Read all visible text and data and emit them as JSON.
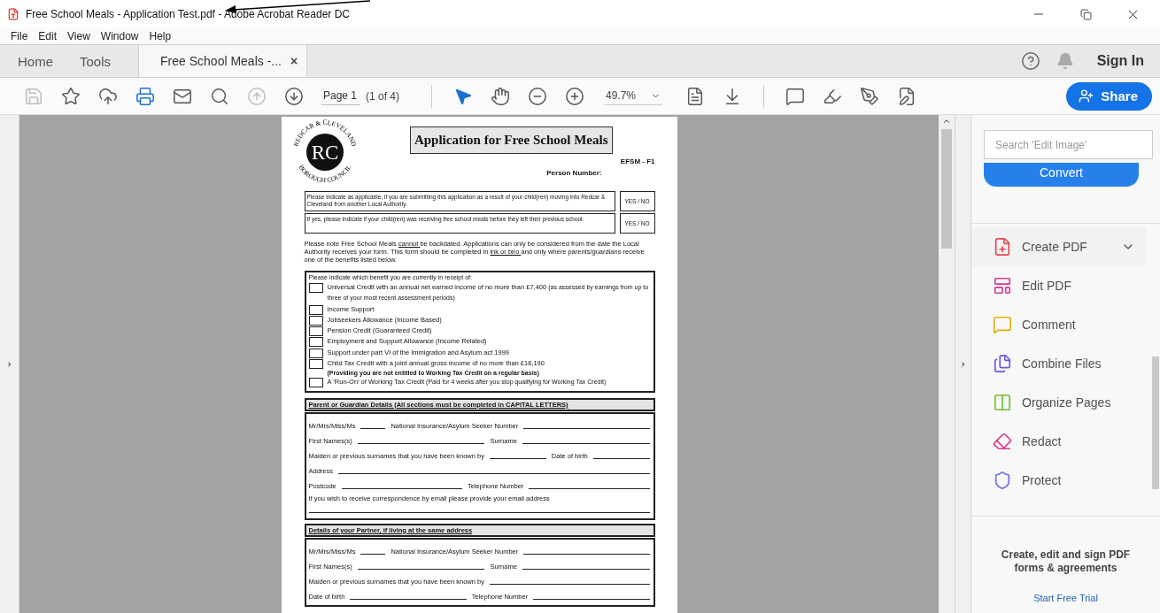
{
  "window": {
    "title": "Free School Meals - Application Test.pdf - Adobe Acrobat Reader DC"
  },
  "menu": [
    "File",
    "Edit",
    "View",
    "Window",
    "Help"
  ],
  "tabs": [
    {
      "label": "Home",
      "selected": false
    },
    {
      "label": "Tools",
      "selected": false
    },
    {
      "label": "Free School Meals -...",
      "selected": true,
      "close": "×"
    }
  ],
  "account": {
    "sign_in": "Sign In"
  },
  "toolbar": {
    "buttons": [
      {
        "kind": "save",
        "disabled": true
      },
      {
        "kind": "bookmark",
        "disabled": false
      },
      {
        "kind": "upload",
        "disabled": false
      },
      {
        "kind": "print",
        "disabled": false
      },
      {
        "kind": "email",
        "disabled": false
      },
      {
        "kind": "find",
        "disabled": false
      },
      {
        "kind": "previous",
        "disabled": true
      },
      {
        "kind": "next",
        "disabled": false
      }
    ],
    "page_field": "Page 1",
    "page_count": "(1 of 4)",
    "view_tools": [
      {
        "kind": "select",
        "selected": true
      },
      {
        "kind": "hand",
        "selected": false
      },
      {
        "kind": "zoom_out",
        "selected": false
      },
      {
        "kind": "zoom_in",
        "selected": false
      }
    ],
    "zoom": "49.7%",
    "edit_tools": [
      {
        "kind": "fit_page"
      },
      {
        "kind": "scroll_mode"
      },
      {
        "kind": "comment"
      },
      {
        "kind": "highlight"
      },
      {
        "kind": "sign"
      },
      {
        "kind": "fill"
      }
    ],
    "share": "Share"
  },
  "document": {
    "logo": {
      "top_text": "REDCAR & CLEVELAND",
      "bottom_text": "BOROUGH COUNCIL",
      "monogram": "RC"
    },
    "title": "Application for Free School Meals",
    "form_code": "EFSM - F1",
    "person_number": "Person Number:",
    "questions": [
      {
        "text": "Please indicate as applicable, if you are submitting this application as a result of your child(ren) moving into Redcar & Cleveland from another Local Authority.",
        "answer": "YES / NO"
      },
      {
        "text": "If yes, please indicate if your child(ren) was receiving free school meals before they left their previous school.",
        "answer": "YES / NO"
      }
    ],
    "notice": [
      {
        "text": "Please note Free School Meals ",
        "underline": false
      },
      {
        "text": "cannot ",
        "underline": true
      },
      {
        "text": "be backdated.  Applications can only be considered from the date the Local Authority receives your form.  This form should be completed in ",
        "underline": false
      },
      {
        "text": "ink or biro ",
        "underline": true
      },
      {
        "text": "and only where parents/guardians receive one of the benefits listed below.",
        "underline": false
      }
    ],
    "benefits": {
      "heading": "Please indicate which benefit you are currently in receipt of:",
      "items": [
        {
          "text": "Universal Credit with an annual net earned income of no more than £7,400",
          "note": {
            "text": "(as assessed by earnings from up to three of your most recent assessment periods)",
            "bold": false
          },
          "checked": false
        },
        {
          "text": "Income Support",
          "checked": false
        },
        {
          "text": "Jobseekers Allowance (Income Based)",
          "checked": false
        },
        {
          "text": "Pension Credit (Guaranteed Credit)",
          "checked": false
        },
        {
          "text": "Employment and Support Allowance (Income Related)",
          "checked": false
        },
        {
          "text": "Support under part VI of the Immigration and Asylum act 1999",
          "checked": false
        },
        {
          "text": "Child Tax Credit with a joint annual gross income of no more than £16,190",
          "note": {
            "text": "(Providing you are not entitled to Working Tax Credit on a regular basis)",
            "bold": true
          },
          "checked": false
        },
        {
          "text": "A ‘Run-On’ of Working Tax Credit",
          "note": {
            "text": "(Paid for 4 weeks after you stop qualifying for Working Tax Credit)",
            "bold": false
          },
          "checked": false
        }
      ]
    },
    "sections": [
      {
        "heading": "Parent or Guardian Details (All sections must be completed in CAPITAL LETTERS)",
        "rows": [
          {
            "fields": [
              {
                "label": "Mr/Mrs/Miss/Ms",
                "kind": "short"
              },
              {
                "label": "National Insurance/Asylum Seeker Number",
                "kind": "inline"
              }
            ]
          },
          {
            "fields": [
              {
                "label": "First Names(s)",
                "kind": "inline"
              },
              {
                "label": "Surname",
                "kind": "inline"
              }
            ]
          },
          {
            "fields": [
              {
                "label": "Maiden or previous surnames that you have been known by",
                "kind": "inline"
              },
              {
                "label": "Date of birth",
                "kind": "inline"
              }
            ]
          },
          {
            "fields": [
              {
                "label": "Address",
                "kind": "inline"
              }
            ]
          },
          {
            "fields": [
              {
                "label": "Postcode",
                "kind": "inline"
              },
              {
                "label": "Telephone Number",
                "kind": "inline"
              }
            ]
          },
          {
            "fields": [
              {
                "label": "If you wish to receive correspondence by email please provide your email address",
                "kind": "below"
              }
            ]
          }
        ]
      },
      {
        "heading": "Details of your Partner, if living at the same address",
        "rows": [
          {
            "fields": [
              {
                "label": "Mr/Mrs/Miss/Ms",
                "kind": "short"
              },
              {
                "label": "National Insurance/Asylum Seeker Number",
                "kind": "inline"
              }
            ]
          },
          {
            "fields": [
              {
                "label": "First Names(s)",
                "kind": "inline"
              },
              {
                "label": "Surname",
                "kind": "inline"
              }
            ]
          },
          {
            "fields": [
              {
                "label": "Maiden or previous surnames that you have been known by",
                "kind": "inline"
              }
            ]
          },
          {
            "fields": [
              {
                "label": "Date of birth",
                "kind": "inline"
              },
              {
                "label": "Telephone Number",
                "kind": "inline"
              }
            ]
          }
        ]
      }
    ]
  },
  "tools_pane": {
    "search_placeholder": "Search 'Edit Image'",
    "convert": "Convert",
    "tools": [
      {
        "kind": "create",
        "label": "Create PDF",
        "expandable": true
      },
      {
        "kind": "edit",
        "label": "Edit PDF",
        "expandable": false
      },
      {
        "kind": "comment",
        "label": "Comment",
        "expandable": false
      },
      {
        "kind": "combine",
        "label": "Combine Files",
        "expandable": false
      },
      {
        "kind": "organize",
        "label": "Organize Pages",
        "expandable": false
      },
      {
        "kind": "redact",
        "label": "Redact",
        "expandable": false
      },
      {
        "kind": "protect",
        "label": "Protect",
        "expandable": false
      }
    ],
    "promo": "Create, edit and sign PDF forms & agreements",
    "trial": "Start Free Trial"
  }
}
